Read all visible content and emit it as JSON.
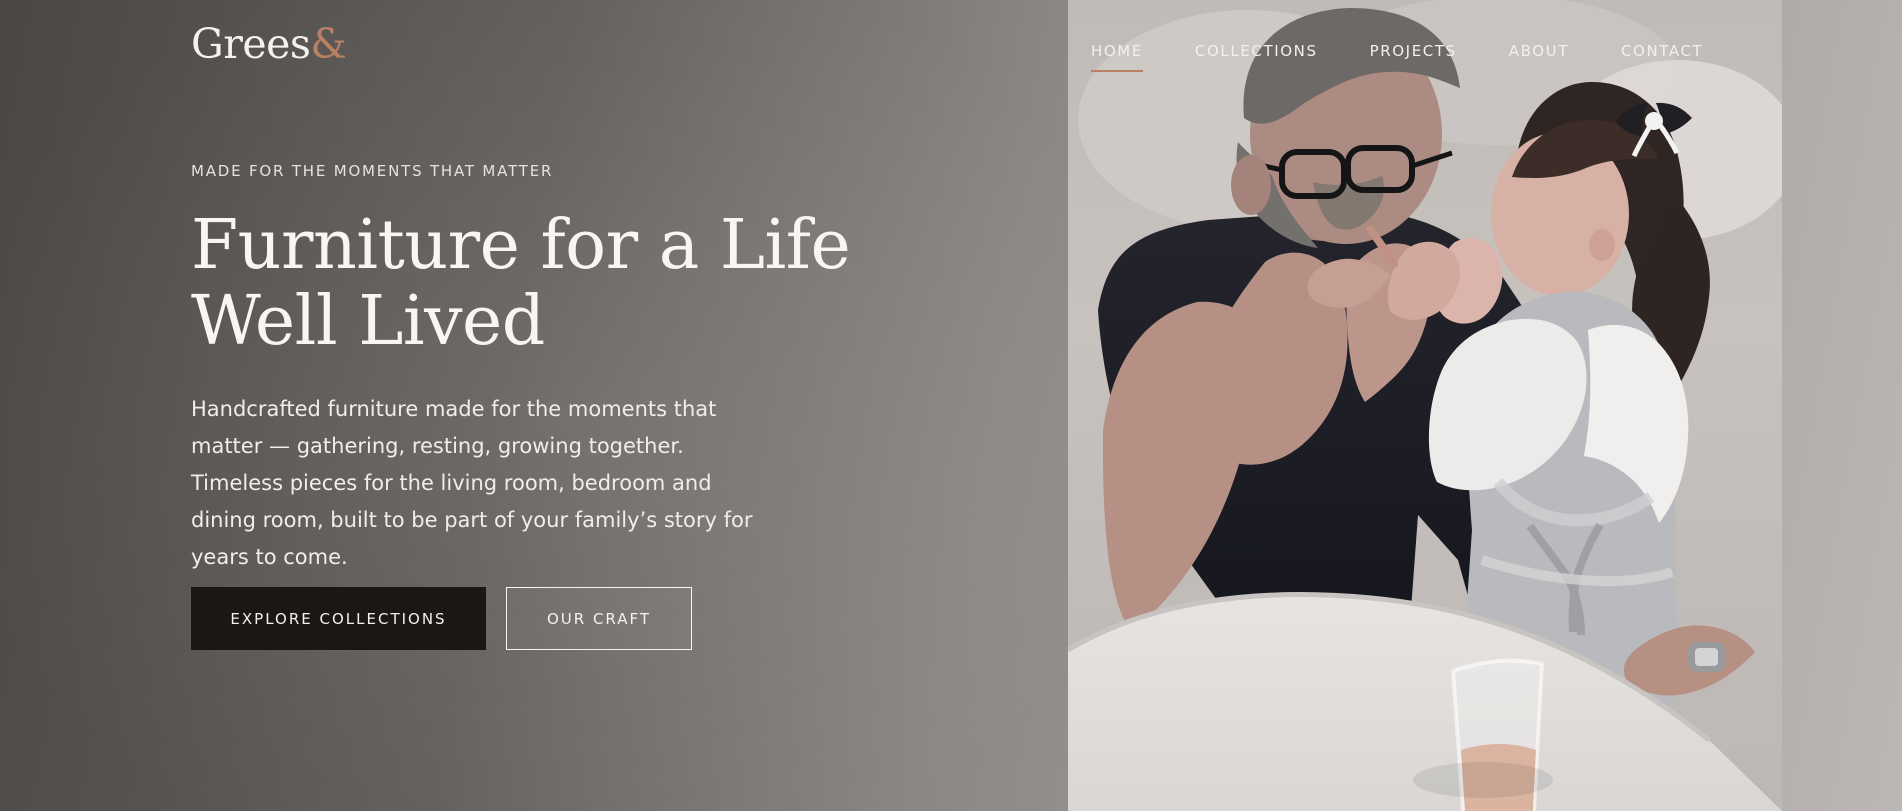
{
  "brand": {
    "name": "Grees",
    "symbol": "&",
    "accent_color": "#b98163"
  },
  "navigation": {
    "items": [
      {
        "label": "HOME",
        "active": true
      },
      {
        "label": "COLLECTIONS",
        "active": false
      },
      {
        "label": "PROJECTS",
        "active": false
      },
      {
        "label": "ABOUT",
        "active": false
      },
      {
        "label": "CONTACT",
        "active": false
      }
    ]
  },
  "hero": {
    "eyebrow": "MADE FOR THE MOMENTS THAT MATTER",
    "headline": "Furniture for a Life Well Lived",
    "description": "Handcrafted furniture made for the moments that matter — gathering, resting, growing together. Timeless pieces for the living room, bedroom and dining room, built to be part of your family’s story for years to come.",
    "primary_cta": "EXPLORE COLLECTIONS",
    "secondary_cta": "OUR CRAFT"
  },
  "colors": {
    "background_dark": "#4a4745",
    "background_light": "#bcb7b5",
    "button_dark": "#1c1713",
    "text_light": "#f4f1ee"
  }
}
